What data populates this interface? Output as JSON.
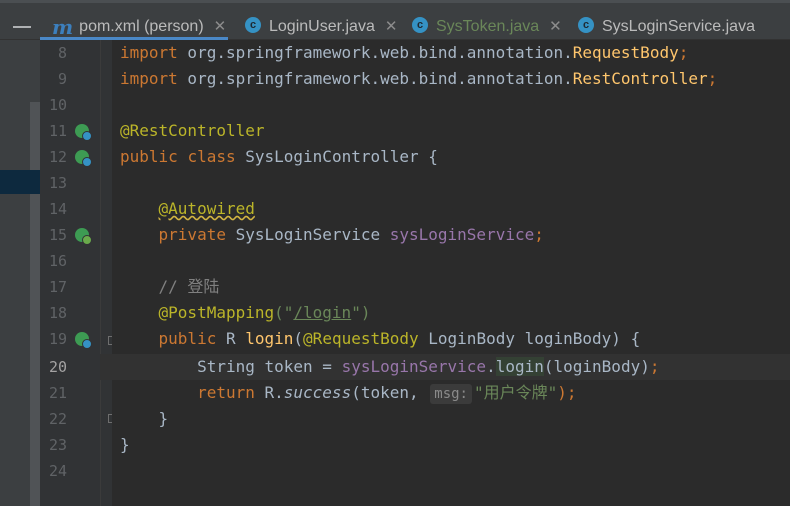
{
  "tabs": [
    {
      "label": "pom.xml (person)",
      "icon": "maven-icon",
      "color": "#bbbbbb"
    },
    {
      "label": "LoginUser.java",
      "icon": "class-icon",
      "color": "#bbbbbb"
    },
    {
      "label": "SysToken.java",
      "icon": "class-icon",
      "color": "#6a8759"
    },
    {
      "label": "SysLoginService.java",
      "icon": "class-icon",
      "color": "#bbbbbb"
    }
  ],
  "gutter": {
    "line_numbers": [
      "8",
      "9",
      "10",
      "11",
      "12",
      "13",
      "14",
      "15",
      "16",
      "17",
      "18",
      "19",
      "20",
      "21",
      "22",
      "23",
      "24"
    ],
    "current_line": "20"
  },
  "code": {
    "l8": {
      "kw": "import",
      "pkg": " org.springframework.web.bind.annotation.",
      "cls": "RequestBody",
      "end": ";"
    },
    "l9": {
      "kw": "import",
      "pkg": " org.springframework.web.bind.annotation.",
      "cls": "RestController",
      "end": ";"
    },
    "l11": {
      "ann": "@RestController"
    },
    "l12": {
      "kw1": "public",
      "kw2": "class",
      "name": " SysLoginController {"
    },
    "l14": {
      "ann": "@Autowired"
    },
    "l15": {
      "kw": "private",
      "type": " SysLoginService ",
      "field": "sysLoginService",
      "end": ";"
    },
    "l17": {
      "comment": "// 登陆"
    },
    "l18": {
      "ann": "@PostMapping",
      "open": "(\"",
      "url": "/login",
      "close": "\")"
    },
    "l19": {
      "kw": "public",
      "ret": " R ",
      "fn": "login",
      "open": "(",
      "ann": "@RequestBody",
      "params": " LoginBody loginBody) {"
    },
    "l20": {
      "type": "String token = ",
      "field": "sysLoginService",
      "dot": ".",
      "call": "login",
      "args": "(loginBody)",
      "end": ";"
    },
    "l21": {
      "kw": "return",
      "cls": " R.",
      "method": "success",
      "args": "(token, ",
      "hint": "msg:",
      "str": "\"用户令牌\"",
      "end": ");"
    },
    "l22": {
      "brace": "}"
    },
    "l23": {
      "brace": "}"
    }
  },
  "colors": {
    "keyword": "#cc7832",
    "annotation": "#bbb529",
    "function": "#ffc66d",
    "field": "#9876aa",
    "string": "#6a8759",
    "comment": "#808080",
    "text": "#a9b7c6"
  }
}
